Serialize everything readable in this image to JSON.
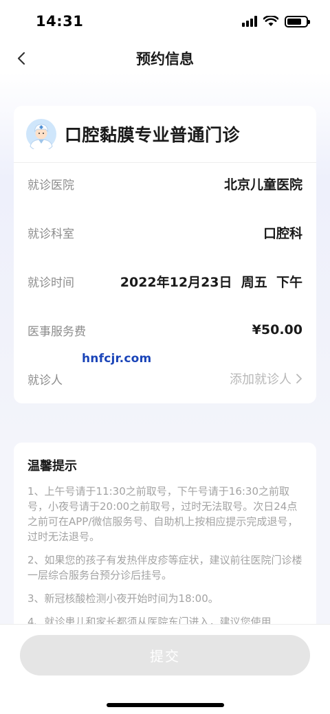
{
  "status_bar": {
    "time": "14:31"
  },
  "nav": {
    "title": "预约信息"
  },
  "clinic_card": {
    "title": "口腔黏膜专业普通门诊",
    "rows": [
      {
        "label": "就诊医院",
        "value": "北京儿童医院"
      },
      {
        "label": "就诊科室",
        "value": "口腔科"
      },
      {
        "label": "就诊时间",
        "value": "2022年12月23日  周五  下午"
      },
      {
        "label": "医事服务费",
        "value": "¥50.00"
      },
      {
        "label": "就诊人",
        "action": "添加就诊人"
      }
    ]
  },
  "watermark": "hnfcjr.com",
  "tips": {
    "title": "温馨提示",
    "items": [
      "1、上午号请于11:30之前取号，下午号请于16:30之前取号，小夜号请于20:00之前取号，过时无法取号。次日24点之前可在APP/微信服务号、自助机上按相应提示完成退号，过时无法退号。",
      "2、如果您的孩子有发热伴皮疹等症状，建议前往医院门诊楼一层综合服务台预分诊后挂号。",
      "3、新冠核酸检测小夜开始时间为18:00。",
      "4、就诊患儿和家长都须从医院东门进入，建议您使用"
    ]
  },
  "footer": {
    "submit_label": "提交"
  },
  "colors": {
    "background": "#f4f5fb",
    "disabled_button": "#e5e5e5",
    "watermark": "#1a44b8",
    "muted_text": "#8c8c8c"
  }
}
